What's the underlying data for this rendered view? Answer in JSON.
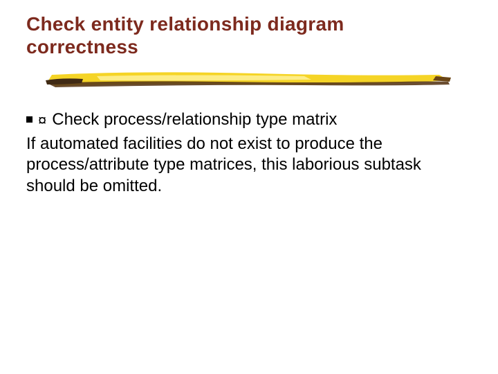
{
  "title": "Check entity relationship diagram correctness",
  "bullet_line": "Check process/relationship type matrix",
  "paragraph": "If automated facilities do not exist to produce the process/attribute type matrices, this laborious subtask should be omitted."
}
